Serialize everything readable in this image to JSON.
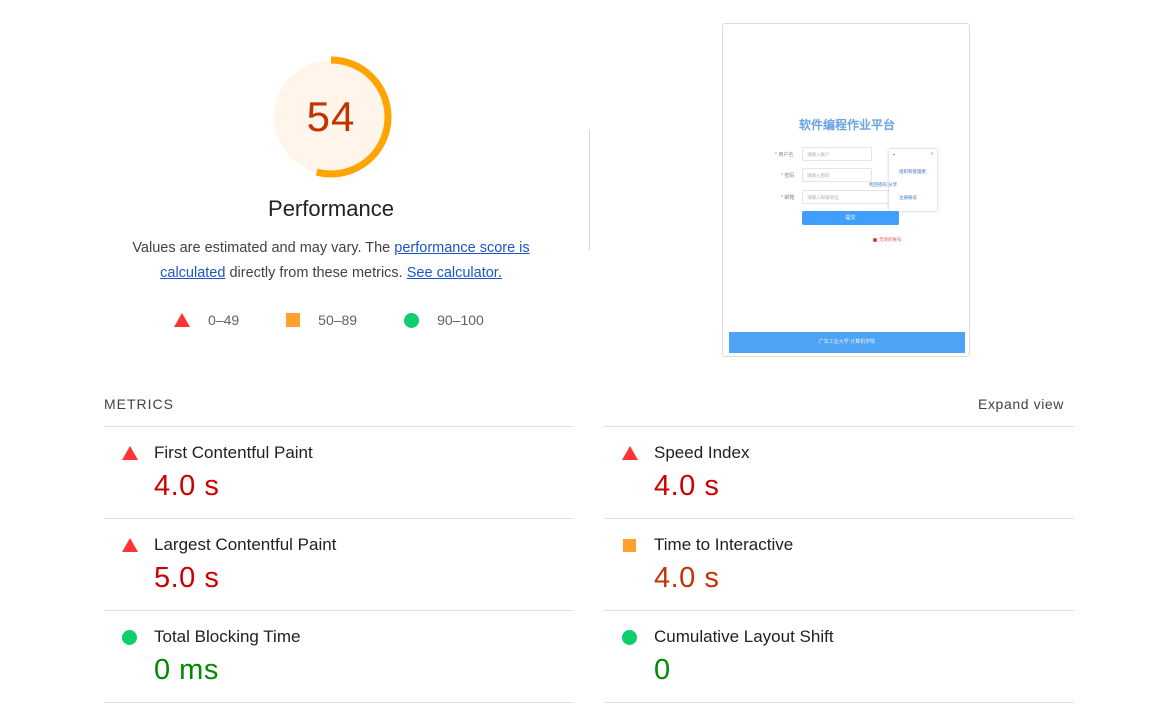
{
  "score": {
    "value": 54,
    "fraction": 0.54,
    "title": "Performance",
    "arc_color": "#ffa400",
    "bg_color": "#fff5ea",
    "text_color": "#c33300"
  },
  "description": {
    "before": "Values are estimated and may vary. The ",
    "link1": "performance score is calculated",
    "middle": " directly from these metrics. ",
    "link2": "See calculator."
  },
  "legend": [
    {
      "icon": "triangle-icon",
      "label": "0–49",
      "color": "#ff3333"
    },
    {
      "icon": "square-icon",
      "label": "50–89",
      "color": "#ffa12e"
    },
    {
      "icon": "circle-icon",
      "label": "90–100",
      "color": "#0cce6b"
    }
  ],
  "screenshot": {
    "title": "软件编程作业平台",
    "fields": [
      {
        "label": "* 用户名",
        "placeholder": "请输入账户"
      },
      {
        "label": "* 密码",
        "placeholder": "请输入密码"
      },
      {
        "label": "* 邮箱",
        "placeholder": "请输入邮箱地址"
      }
    ],
    "popup_items": [
      "组织和管理者",
      "找回密码 分享",
      "注册账号",
      "找回账号"
    ],
    "popup_close": "×",
    "button": "提交",
    "error": "无效的账号",
    "footer": "广东工业大学 计算机学院"
  },
  "metrics": {
    "title": "METRICS",
    "expand": "Expand view",
    "left": [
      {
        "name": "First Contentful Paint",
        "value": "4.0 s",
        "status": "fail",
        "icon": "triangle-icon"
      },
      {
        "name": "Largest Contentful Paint",
        "value": "5.0 s",
        "status": "fail",
        "icon": "triangle-icon"
      },
      {
        "name": "Total Blocking Time",
        "value": "0 ms",
        "status": "pass",
        "icon": "circle-icon"
      }
    ],
    "right": [
      {
        "name": "Speed Index",
        "value": "4.0 s",
        "status": "fail",
        "icon": "triangle-icon"
      },
      {
        "name": "Time to Interactive",
        "value": "4.0 s",
        "status": "avg",
        "icon": "square-icon"
      },
      {
        "name": "Cumulative Layout Shift",
        "value": "0",
        "status": "pass",
        "icon": "circle-icon"
      }
    ]
  }
}
